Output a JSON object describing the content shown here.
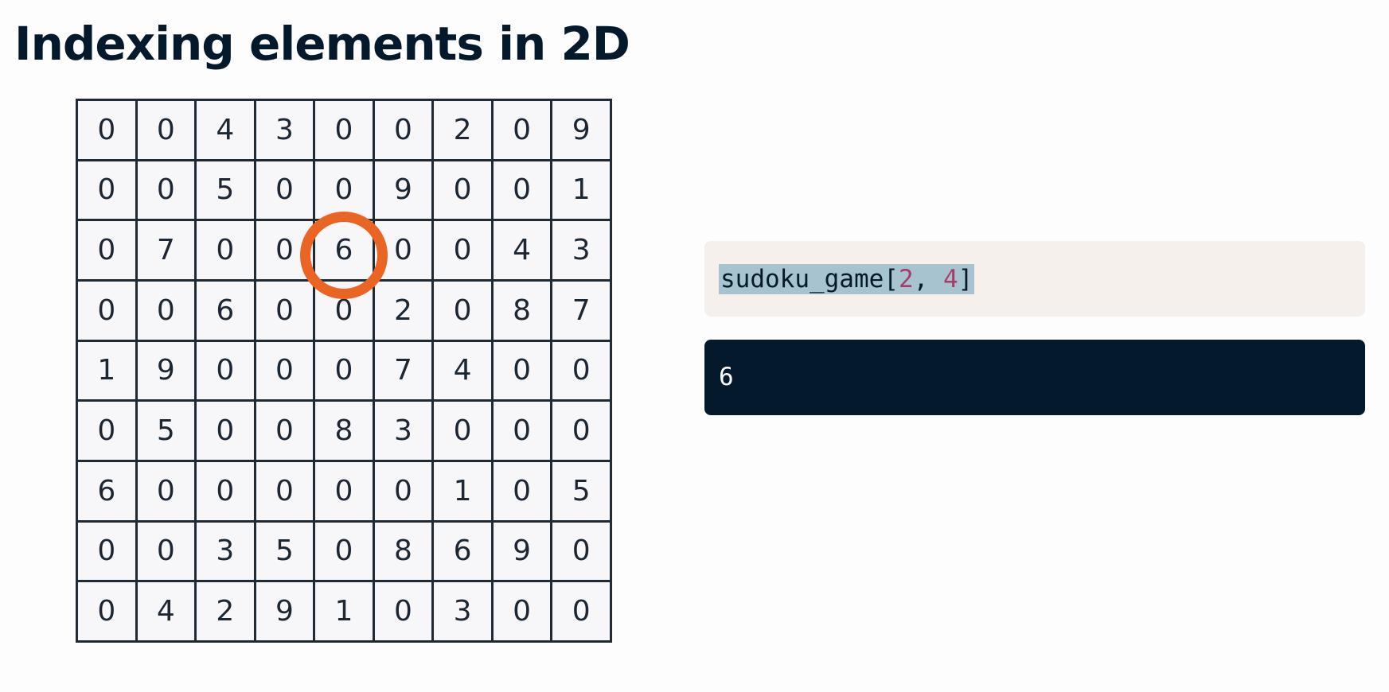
{
  "title": "Indexing elements in 2D",
  "sudoku": {
    "rows": [
      [
        "0",
        "0",
        "4",
        "3",
        "0",
        "0",
        "2",
        "0",
        "9"
      ],
      [
        "0",
        "0",
        "5",
        "0",
        "0",
        "9",
        "0",
        "0",
        "1"
      ],
      [
        "0",
        "7",
        "0",
        "0",
        "6",
        "0",
        "0",
        "4",
        "3"
      ],
      [
        "0",
        "0",
        "6",
        "0",
        "0",
        "2",
        "0",
        "8",
        "7"
      ],
      [
        "1",
        "9",
        "0",
        "0",
        "0",
        "7",
        "4",
        "0",
        "0"
      ],
      [
        "0",
        "5",
        "0",
        "0",
        "8",
        "3",
        "0",
        "0",
        "0"
      ],
      [
        "6",
        "0",
        "0",
        "0",
        "0",
        "0",
        "1",
        "0",
        "5"
      ],
      [
        "0",
        "0",
        "3",
        "5",
        "0",
        "8",
        "6",
        "9",
        "0"
      ],
      [
        "0",
        "4",
        "2",
        "9",
        "1",
        "0",
        "3",
        "0",
        "0"
      ]
    ],
    "highlight": {
      "row": 2,
      "col": 4
    }
  },
  "code": {
    "prefix": "sudoku_game[",
    "index1": "2",
    "separator": ", ",
    "index2": "4",
    "suffix": "]"
  },
  "output": "6",
  "colors": {
    "title": "#05192d",
    "highlight_ring": "#ea6424",
    "code_background": "#f5f0ec",
    "code_selection": "#a8c3d0",
    "code_number": "#a53d69",
    "output_background": "#05192d",
    "output_text": "#ffffff"
  }
}
